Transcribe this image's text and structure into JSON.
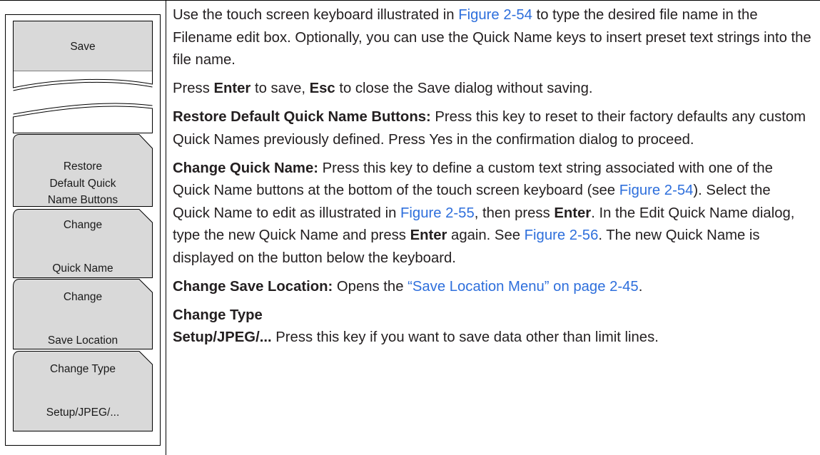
{
  "menu": {
    "save_label": "Save",
    "restore": {
      "line1": "Restore",
      "line2": "Default Quick",
      "line3": "Name Buttons"
    },
    "change_quick_name": {
      "line1": "Change",
      "line2": "Quick Name"
    },
    "change_save_location": {
      "line1": "Change",
      "line2": "Save Location"
    },
    "change_type": {
      "line1": "Change Type",
      "line2": "Setup/JPEG/..."
    }
  },
  "content": {
    "p1": {
      "a": "Use the touch screen keyboard illustrated in ",
      "link": "Figure 2-54",
      "b": " to type the desired file name in the Filename edit box. Optionally, you can use the Quick Name keys to insert preset text strings into the file name."
    },
    "p2": {
      "a": "Press ",
      "enter": "Enter",
      "b": " to save, ",
      "esc": "Esc",
      "c": " to close the Save dialog without saving."
    },
    "p3": {
      "heading": "Restore Default Quick Name Buttons:",
      "text": " Press this key to reset to their factory defaults any custom Quick Names previously defined. Press Yes in the confirmation dialog to proceed."
    },
    "p4": {
      "heading": "Change Quick Name:",
      "a": " Press this key to define a custom text string associated with one of the Quick Name buttons at the bottom of the touch screen keyboard (see ",
      "link1": "Figure 2-54",
      "b": "). Select the Quick Name to edit as illustrated in ",
      "link2": "Figure 2-55",
      "c": ", then press ",
      "enter1": "Enter",
      "d": ". In the Edit Quick Name dialog, type the new Quick Name and press ",
      "enter2": "Enter",
      "e": " again. See ",
      "link3": "Figure 2-56",
      "f": ". The new Quick Name is displayed on the button below the keyboard."
    },
    "p5": {
      "heading": "Change Save Location:",
      "a": " Opens the ",
      "link": "“Save Location Menu” on page 2-45",
      "b": "."
    },
    "p6": {
      "heading1": "Change Type",
      "heading2": "Setup/JPEG/...",
      "text": " Press this key if you want to save data other than limit lines."
    }
  },
  "colors": {
    "link": "#2e6fdc",
    "key_fill": "#d9d9d9",
    "text": "#231f20"
  }
}
